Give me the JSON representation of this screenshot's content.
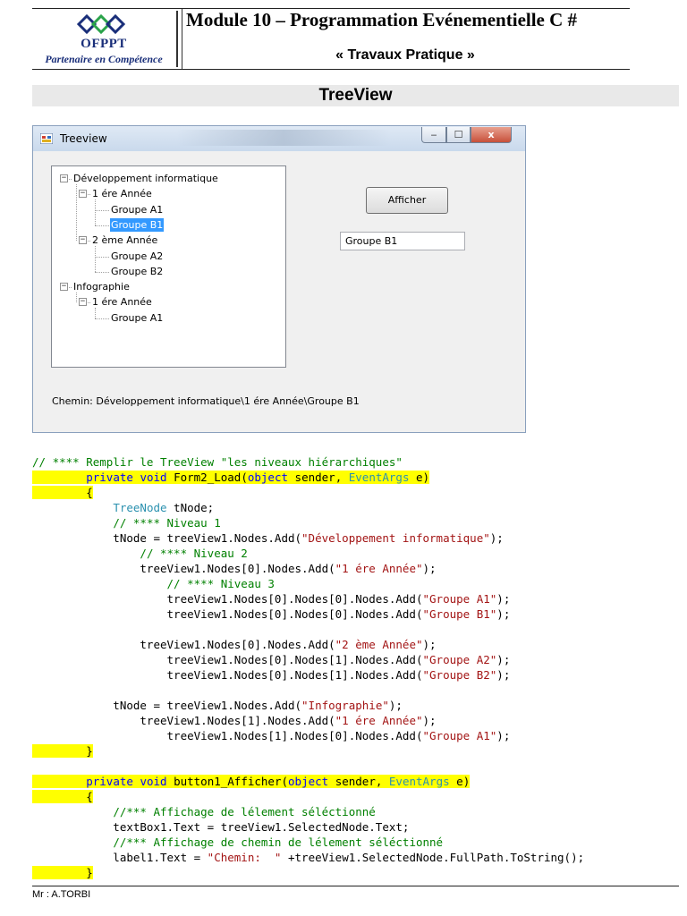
{
  "header": {
    "org": "OFPPT",
    "partner": "Partenaire en Compétence",
    "module_title": "Module 10 – Programmation Evénementielle C #",
    "subtitle": "« Travaux Pratique »"
  },
  "section_title": "TreeView",
  "window": {
    "title": "Treeview",
    "controls": {
      "minimize": "‒",
      "maximize": "☐",
      "close": "x"
    },
    "tree_nodes": [
      {
        "label": "Développement informatique",
        "level": 0,
        "expand": "−"
      },
      {
        "label": "1 ére Année",
        "level": 1,
        "expand": "−"
      },
      {
        "label": "Groupe A1",
        "level": 2,
        "expand": ""
      },
      {
        "label": "Groupe B1",
        "level": 2,
        "expand": "",
        "selected": true
      },
      {
        "label": "2 ème Année",
        "level": 1,
        "expand": "−"
      },
      {
        "label": "Groupe A2",
        "level": 2,
        "expand": ""
      },
      {
        "label": "Groupe B2",
        "level": 2,
        "expand": ""
      },
      {
        "label": "Infographie",
        "level": 0,
        "expand": "−"
      },
      {
        "label": "1 ére Année",
        "level": 1,
        "expand": "−"
      },
      {
        "label": "Groupe A1",
        "level": 2,
        "expand": ""
      }
    ],
    "button_label": "Afficher",
    "textbox_value": "Groupe B1",
    "path_label": "Chemin:  Développement informatique\\1 ére Année\\Groupe B1"
  },
  "code_lines": [
    {
      "hl": false,
      "parts": [
        {
          "c": "c",
          "t": "// **** Remplir le TreeView \"les niveaux hiérarchiques\""
        }
      ]
    },
    {
      "hl": true,
      "parts": [
        {
          "t": "        "
        },
        {
          "c": "k",
          "t": "private"
        },
        {
          "t": " "
        },
        {
          "c": "k",
          "t": "void"
        },
        {
          "t": " Form2_Load("
        },
        {
          "c": "k",
          "t": "object"
        },
        {
          "t": " sender, "
        },
        {
          "c": "t",
          "t": "EventArgs"
        },
        {
          "t": " e)"
        }
      ]
    },
    {
      "hl": true,
      "parts": [
        {
          "t": "        {"
        }
      ]
    },
    {
      "hl": false,
      "parts": [
        {
          "t": "            "
        },
        {
          "c": "t",
          "t": "TreeNode"
        },
        {
          "t": " tNode;"
        }
      ]
    },
    {
      "hl": false,
      "parts": [
        {
          "t": "            "
        },
        {
          "c": "c",
          "t": "// **** Niveau 1"
        }
      ]
    },
    {
      "hl": false,
      "parts": [
        {
          "t": "            tNode = treeView1.Nodes.Add("
        },
        {
          "c": "s",
          "t": "\"Développement informatique\""
        },
        {
          "t": ");"
        }
      ]
    },
    {
      "hl": false,
      "parts": [
        {
          "t": "                "
        },
        {
          "c": "c",
          "t": "// **** Niveau 2"
        }
      ]
    },
    {
      "hl": false,
      "parts": [
        {
          "t": "                treeView1.Nodes[0].Nodes.Add("
        },
        {
          "c": "s",
          "t": "\"1 ére Année\""
        },
        {
          "t": ");"
        }
      ]
    },
    {
      "hl": false,
      "parts": [
        {
          "t": "                    "
        },
        {
          "c": "c",
          "t": "// **** Niveau 3"
        }
      ]
    },
    {
      "hl": false,
      "parts": [
        {
          "t": "                    treeView1.Nodes[0].Nodes[0].Nodes.Add("
        },
        {
          "c": "s",
          "t": "\"Groupe A1\""
        },
        {
          "t": ");"
        }
      ]
    },
    {
      "hl": false,
      "parts": [
        {
          "t": "                    treeView1.Nodes[0].Nodes[0].Nodes.Add("
        },
        {
          "c": "s",
          "t": "\"Groupe B1\""
        },
        {
          "t": ");"
        }
      ]
    },
    {
      "hl": false,
      "parts": [
        {
          "t": ""
        }
      ]
    },
    {
      "hl": false,
      "parts": [
        {
          "t": "                treeView1.Nodes[0].Nodes.Add("
        },
        {
          "c": "s",
          "t": "\"2 ème Année\""
        },
        {
          "t": ");"
        }
      ]
    },
    {
      "hl": false,
      "parts": [
        {
          "t": "                    treeView1.Nodes[0].Nodes[1].Nodes.Add("
        },
        {
          "c": "s",
          "t": "\"Groupe A2\""
        },
        {
          "t": ");"
        }
      ]
    },
    {
      "hl": false,
      "parts": [
        {
          "t": "                    treeView1.Nodes[0].Nodes[1].Nodes.Add("
        },
        {
          "c": "s",
          "t": "\"Groupe B2\""
        },
        {
          "t": ");"
        }
      ]
    },
    {
      "hl": false,
      "parts": [
        {
          "t": ""
        }
      ]
    },
    {
      "hl": false,
      "parts": [
        {
          "t": "            tNode = treeView1.Nodes.Add("
        },
        {
          "c": "s",
          "t": "\"Infographie\""
        },
        {
          "t": ");"
        }
      ]
    },
    {
      "hl": false,
      "parts": [
        {
          "t": "                treeView1.Nodes[1].Nodes.Add("
        },
        {
          "c": "s",
          "t": "\"1 ére Année\""
        },
        {
          "t": ");"
        }
      ]
    },
    {
      "hl": false,
      "parts": [
        {
          "t": "                    treeView1.Nodes[1].Nodes[0].Nodes.Add("
        },
        {
          "c": "s",
          "t": "\"Groupe A1\""
        },
        {
          "t": ");"
        }
      ]
    },
    {
      "hl": true,
      "parts": [
        {
          "t": "        }"
        }
      ]
    },
    {
      "hl": false,
      "parts": [
        {
          "t": ""
        }
      ]
    },
    {
      "hl": true,
      "parts": [
        {
          "t": "        "
        },
        {
          "c": "k",
          "t": "private"
        },
        {
          "t": " "
        },
        {
          "c": "k",
          "t": "void"
        },
        {
          "t": " button1_Afficher("
        },
        {
          "c": "k",
          "t": "object"
        },
        {
          "t": " sender, "
        },
        {
          "c": "t",
          "t": "EventArgs"
        },
        {
          "t": " e)"
        }
      ]
    },
    {
      "hl": true,
      "parts": [
        {
          "t": "        {"
        }
      ]
    },
    {
      "hl": false,
      "parts": [
        {
          "t": "            "
        },
        {
          "c": "c",
          "t": "//*** Affichage de lélement séléctionné"
        }
      ]
    },
    {
      "hl": false,
      "parts": [
        {
          "t": "            textBox1.Text = treeView1.SelectedNode.Text;"
        }
      ]
    },
    {
      "hl": false,
      "parts": [
        {
          "t": "            "
        },
        {
          "c": "c",
          "t": "//*** Affichage de chemin de lélement séléctionné"
        }
      ]
    },
    {
      "hl": false,
      "parts": [
        {
          "t": "            label1.Text = "
        },
        {
          "c": "s",
          "t": "\"Chemin:  \""
        },
        {
          "t": " +treeView1.SelectedNode.FullPath.ToString();"
        }
      ]
    },
    {
      "hl": true,
      "parts": [
        {
          "t": "        }"
        }
      ]
    }
  ],
  "footer": "Mr : A.TORBI",
  "colors": {
    "keyword": "#0000ff",
    "type": "#2b91af",
    "string": "#a31515",
    "comment": "#008000",
    "highlight": "#ffff00",
    "selection": "#3399ff"
  }
}
